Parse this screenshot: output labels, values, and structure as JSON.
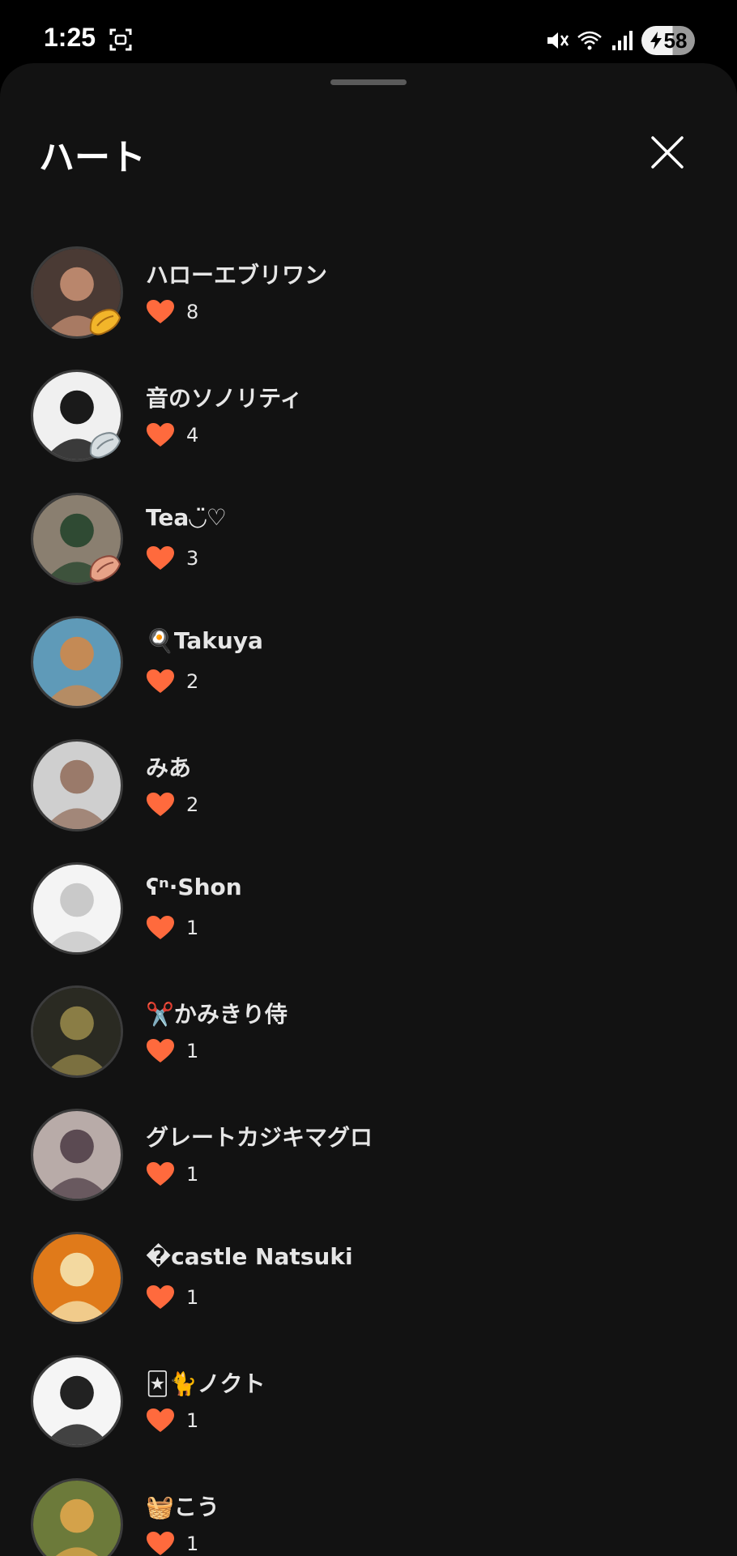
{
  "status_bar": {
    "time": "1:25",
    "battery_level": "58",
    "icons": [
      "screenshot-icon",
      "mute-icon",
      "wifi-icon",
      "signal-icon",
      "charging-icon"
    ]
  },
  "sheet": {
    "title": "ハート",
    "close_icon": "close-icon"
  },
  "colors": {
    "background": "#121212",
    "heart": "#ff6a3d"
  },
  "likes": [
    {
      "name": "ハローエブリワン",
      "count": "8",
      "avatar_colors": [
        "#4a3a34",
        "#b9866c"
      ],
      "badge": "gold"
    },
    {
      "name": "音のソノリティ",
      "count": "4",
      "avatar_colors": [
        "#f0f0f0",
        "#1a1a1a"
      ],
      "badge": "silver"
    },
    {
      "name": "Tea◡̈♡",
      "count": "3",
      "avatar_colors": [
        "#8a7f70",
        "#2f4a33"
      ],
      "badge": "bronze"
    },
    {
      "name": "🍳Takuya",
      "count": "2",
      "avatar_colors": [
        "#5f9ab8",
        "#c48a55"
      ],
      "badge": ""
    },
    {
      "name": "みあ",
      "count": "2",
      "avatar_colors": [
        "#cfcfcf",
        "#9a7a6a"
      ],
      "badge": ""
    },
    {
      "name": "ʕⁿ·Shon",
      "count": "1",
      "avatar_colors": [
        "#f4f4f4",
        "#c9c9c9"
      ],
      "badge": ""
    },
    {
      "name": "✂️かみきり侍",
      "count": "1",
      "avatar_colors": [
        "#2a2a22",
        "#8a7d45"
      ],
      "badge": ""
    },
    {
      "name": "グレートカジキマグロ",
      "count": "1",
      "avatar_colors": [
        "#b8aba8",
        "#5b4a52"
      ],
      "badge": ""
    },
    {
      "name": "�castle Natsuki",
      "count": "1",
      "avatar_colors": [
        "#e07a1a",
        "#f3d9a0"
      ],
      "badge": ""
    },
    {
      "name": "🃏🐈ノクト",
      "count": "1",
      "avatar_colors": [
        "#f5f5f5",
        "#222222"
      ],
      "badge": ""
    },
    {
      "name": "🧺こう",
      "count": "1",
      "avatar_colors": [
        "#6c7a3a",
        "#d4a24a"
      ],
      "badge": ""
    }
  ]
}
